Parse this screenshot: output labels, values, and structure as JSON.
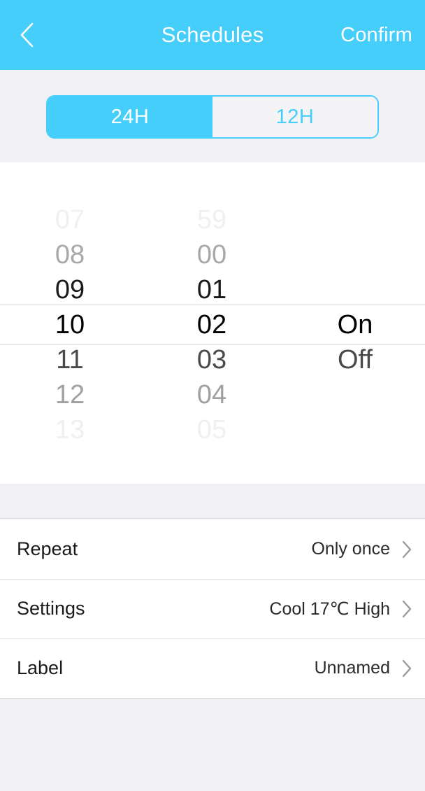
{
  "colors": {
    "accent": "#46cefa",
    "header_bg": "#46cefa",
    "page_bg": "#f1f1f5",
    "card_bg": "#ffffff",
    "separator": "#dddddd",
    "chevron": "#9a9a9a"
  },
  "header": {
    "back_icon": "chevron-left-icon",
    "title": "Schedules",
    "confirm_label": "Confirm"
  },
  "time_format_toggle": {
    "options": [
      {
        "label": "24H",
        "selected": true
      },
      {
        "label": "12H",
        "selected": false
      }
    ]
  },
  "time_picker": {
    "selected": {
      "hour": "10",
      "minute": "02",
      "mode": "On"
    },
    "hours": [
      "07",
      "08",
      "09",
      "10",
      "11",
      "12",
      "13"
    ],
    "minutes": [
      "59",
      "00",
      "01",
      "02",
      "03",
      "04",
      "05"
    ],
    "modes": [
      "",
      "",
      "",
      "On",
      "Off",
      "",
      ""
    ],
    "selected_index": 3
  },
  "settings_list": {
    "rows": [
      {
        "label": "Repeat",
        "value": "Only once",
        "chevron": "chevron-right-icon"
      },
      {
        "label": "Settings",
        "value": "Cool 17℃ High",
        "chevron": "chevron-right-icon"
      },
      {
        "label": "Label",
        "value": "Unnamed",
        "chevron": "chevron-right-icon"
      }
    ]
  }
}
